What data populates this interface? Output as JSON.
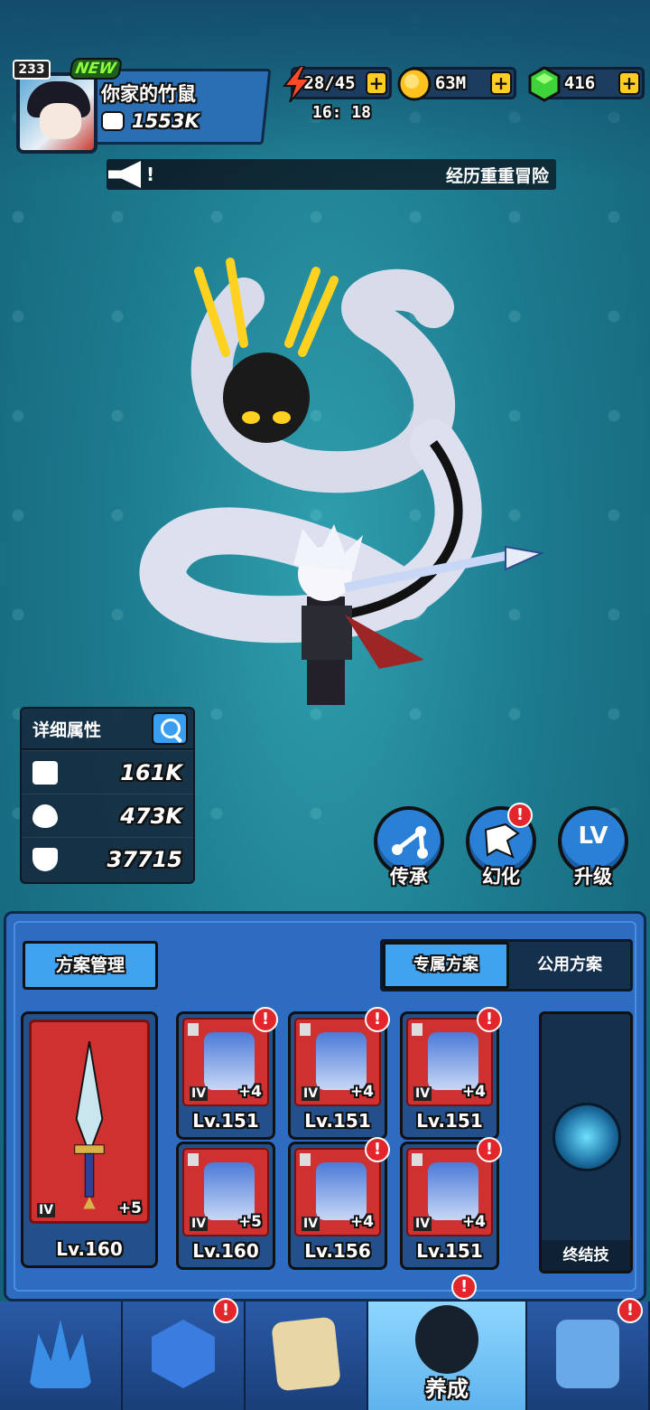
{
  "player": {
    "level": "233",
    "new_badge": "NEW",
    "name": "你家的竹鼠",
    "power": "1553K"
  },
  "resources": {
    "energy": "28/45",
    "timer": "16: 18",
    "gold": "63M",
    "gems": "416",
    "plus": "+"
  },
  "broadcast": {
    "icon": "megaphone-icon",
    "prefix": "!",
    "text": "经历重重冒险"
  },
  "stats": {
    "title": "详细属性",
    "rows": [
      {
        "icon": "sword-icon",
        "value": "161K"
      },
      {
        "icon": "heart-icon",
        "value": "473K"
      },
      {
        "icon": "shield-icon",
        "value": "37715"
      }
    ]
  },
  "actions": [
    {
      "label": "传承",
      "icon": "branch-icon"
    },
    {
      "label": "幻化",
      "icon": "dragon-icon",
      "alert": "!"
    },
    {
      "label": "升级",
      "icon": "level-up-icon",
      "glyph": "LV"
    }
  ],
  "panel": {
    "scheme_button": "方案管理",
    "tabs": [
      "专属方案",
      "公用方案"
    ],
    "weapon": {
      "tier": "IV",
      "plus": "+5",
      "level": "Lv.160"
    },
    "gear": [
      {
        "tier": "IV",
        "plus": "+4",
        "level": "Lv.151",
        "alert": "!"
      },
      {
        "tier": "IV",
        "plus": "+4",
        "level": "Lv.151",
        "alert": "!"
      },
      {
        "tier": "IV",
        "plus": "+4",
        "level": "Lv.151",
        "alert": "!"
      },
      {
        "tier": "IV",
        "plus": "+5",
        "level": "Lv.160"
      },
      {
        "tier": "IV",
        "plus": "+4",
        "level": "Lv.156",
        "alert": "!"
      },
      {
        "tier": "IV",
        "plus": "+4",
        "level": "Lv.151",
        "alert": "!"
      }
    ],
    "ultimate": "终结技"
  },
  "nav": {
    "active_label": "养成",
    "alert": "!"
  },
  "colors": {
    "accent": "#3fa3f0",
    "card_red": "#cf3131",
    "alert": "#e3262c"
  }
}
